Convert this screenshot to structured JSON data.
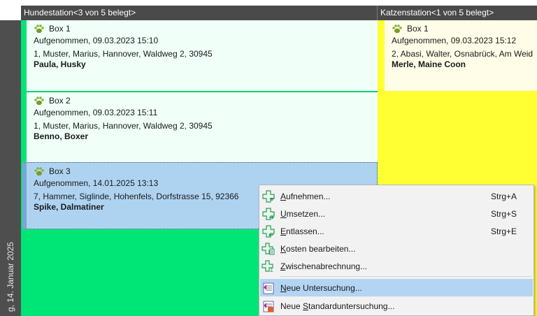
{
  "date_label": "g, 14. Januar 2025",
  "stations": [
    {
      "header": "Hundestation<3 von 5 belegt>",
      "boxes": [
        {
          "title": "Box 1",
          "admitted": "Aufgenommen, 09.03.2023 15:10",
          "owner": "1, Muster, Marius, Hannover, Waldweg 2, 30945",
          "pet": "Paula, Husky"
        },
        {
          "title": "Box 2",
          "admitted": "Aufgenommen, 09.03.2023 15:11",
          "owner": "1, Muster, Marius, Hannover, Waldweg 2, 30945",
          "pet": "Benno, Boxer"
        },
        {
          "title": "Box 3",
          "admitted": "Aufgenommen, 14.01.2025 13:13",
          "owner": "7, Hammer, Siglinde, Hohenfels, Dorfstrasse 15, 92366",
          "pet": "Spike, Dalmatiner"
        }
      ]
    },
    {
      "header": "Katzenstation<1 von 5 belegt>",
      "boxes": [
        {
          "title": "Box 1",
          "admitted": "Aufgenommen, 09.03.2023 15:12",
          "owner": "2, Abasi, Walter, Osnabrück, Am Weid",
          "pet": "Merle, Maine Coon"
        }
      ]
    }
  ],
  "context_menu": {
    "items": [
      {
        "pre": "",
        "ul": "A",
        "post": "ufnehmen...",
        "shortcut": "Strg+A",
        "icon": "add-cross-icon"
      },
      {
        "pre": "",
        "ul": "U",
        "post": "msetzen...",
        "shortcut": "Strg+S",
        "icon": "move-cross-icon"
      },
      {
        "pre": "",
        "ul": "E",
        "post": "ntlassen...",
        "shortcut": "Strg+E",
        "icon": "discharge-cross-icon"
      },
      {
        "pre": "",
        "ul": "K",
        "post": "osten bearbeiten...",
        "shortcut": "",
        "icon": "costs-cross-icon"
      },
      {
        "pre": "",
        "ul": "Z",
        "post": "wischenabrechnung...",
        "shortcut": "",
        "icon": "interim-billing-cross-icon"
      },
      {
        "pre": "",
        "ul": "N",
        "post": "eue Untersuchung...",
        "shortcut": "",
        "icon": "examination-icon"
      },
      {
        "pre": "Neue ",
        "ul": "S",
        "post": "tandarduntersuchung...",
        "shortcut": "",
        "icon": "standard-examination-icon"
      }
    ],
    "highlighted_index": 5
  },
  "colors": {
    "dog_station": "#00e676",
    "cat_station": "#ffff33",
    "selected_box": "#aed3f1",
    "menu_highlight": "#b3d4f3",
    "header_bg": "#4a4a4a"
  }
}
